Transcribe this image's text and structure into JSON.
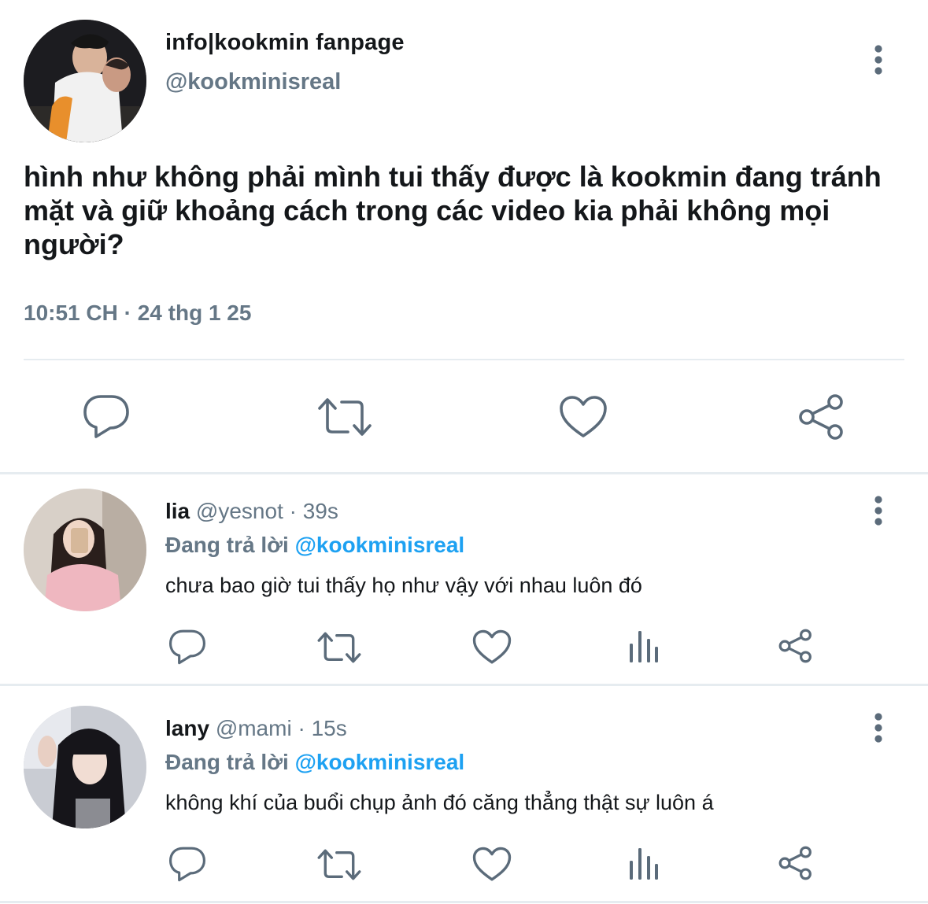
{
  "main_tweet": {
    "display_name": "info|kookmin fanpage",
    "handle": "@kookminisreal",
    "text": "hình như không phải mình tui thấy được là kookmin đang tránh mặt và giữ khoảng cách trong các video kia phải không mọi người?",
    "timestamp": "10:51 CH · 24 thg 1 25",
    "icons": [
      "reply-icon",
      "retweet-icon",
      "like-icon",
      "share-icon",
      "more-icon"
    ]
  },
  "replies": [
    {
      "name": "lia",
      "handle": "@yesnot",
      "time": "39s",
      "replying_prefix": "Đang trả lời",
      "replying_to": "@kookminisreal",
      "text": "chưa bao giờ tui thấy họ như vậy với nhau luôn đó"
    },
    {
      "name": "lany",
      "handle": "@mami",
      "time": "15s",
      "replying_prefix": "Đang trả lời",
      "replying_to": "@kookminisreal",
      "text": "không khí của buổi chụp ảnh đó căng thẳng thật sự luôn á"
    }
  ],
  "separator": "·",
  "colors": {
    "text": "#14171a",
    "secondary": "#657786",
    "accent": "#1da1f2",
    "divider": "#e6ecf0"
  }
}
